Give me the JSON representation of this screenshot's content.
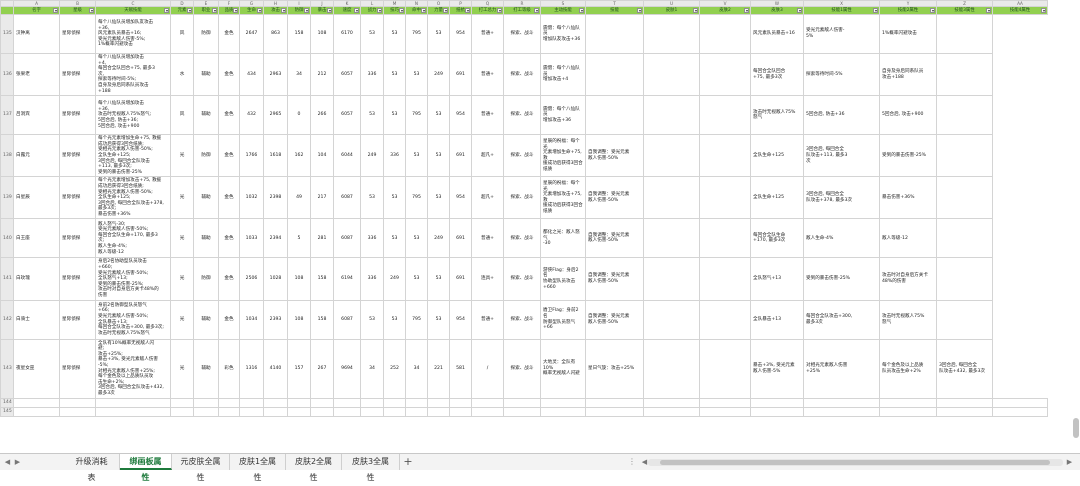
{
  "columns": [
    "",
    "A",
    "B",
    "C",
    "D",
    "E",
    "F",
    "G",
    "H",
    "I",
    "J",
    "K",
    "L",
    "M",
    "N",
    "O",
    "P",
    "Q",
    "R",
    "S",
    "T",
    "U",
    "V",
    "W",
    "X",
    "Y",
    "Z",
    "AA",
    "AB"
  ],
  "headers": [
    "名字",
    "星级",
    "天赋技能",
    "元素",
    "职业",
    "品质",
    "生命",
    "攻击",
    "防御",
    "暴击",
    "速度",
    "战力",
    "技巧",
    "命中",
    "力量",
    "抵抗",
    "打工总力",
    "打工等级",
    "主动技能",
    "技能",
    "皮肤1",
    "皮肤2",
    "皮肤3",
    "技能1属性",
    "技能2属性",
    "技能3属性",
    "技能4属性"
  ],
  "rows": [
    {
      "num": "135",
      "cells": [
        "汉钟离",
        "星际侦探",
        "每个八仙队员增加队友攻击\n+36,\n风元素队员暴击+16;\n受光元素敌人伤害-5%;\n1%概率闪避攻击",
        "风",
        "防御",
        "金色",
        "2647",
        "863",
        "158",
        "108",
        "6170",
        "53",
        "53",
        "795",
        "53",
        "954",
        "普通+",
        "探索、战斗",
        "震慑：每个八仙队员\n增加队友攻击+36",
        "",
        "",
        "",
        "风元素队员暴击+16",
        "受光元素敌人伤害-\n5%",
        "1%概率闪避攻击",
        ""
      ]
    },
    {
      "num": "136",
      "cells": [
        "张果老",
        "星际侦探",
        "每个八仙队员增加攻击\n+4,\n每回合全队回合+75, 最多3\n次,\n探索等待时间-5%;\n自身及身后同系队员攻击\n+188",
        "水",
        "辅助",
        "金色",
        "434",
        "2963",
        "34",
        "212",
        "6057",
        "336",
        "53",
        "53",
        "249",
        "691",
        "普通+",
        "探索、战斗",
        "震慑：每个八仙队员\n增加攻击+4",
        "",
        "",
        "",
        "每回合全队回合\n+75, 最多3次",
        "探索等待时间-5%",
        "自身及身后同系队员\n攻击+188",
        ""
      ]
    },
    {
      "num": "137",
      "cells": [
        "吕洞宾",
        "星际侦探",
        "每个八仙队员增加攻击\n+36,\n攻击时无视敌人75%怒气;\n5回合后, 防击+36;\n5回合后, 攻击+900",
        "风",
        "辅助",
        "金色",
        "432",
        "2965",
        "0",
        "266",
        "6057",
        "53",
        "53",
        "795",
        "53",
        "954",
        "普通+",
        "探索、战斗",
        "震慑：每个八仙队员\n增加攻击+36",
        "",
        "",
        "",
        "攻击时无视敌人75%\n怒气",
        "5回合后, 防击+36",
        "5回合后, 攻击+900",
        ""
      ]
    },
    {
      "num": "138",
      "cells": [
        "白露元",
        "星际侦探",
        "每个光元素增加生命+75, 救援\n成功后获得3回合纸质;\n受相光元素敌人伤害-50%;\n全队生命+125;\n3回合后, 每回合全队攻击\n+113, 最多3次;\n受到的暴击伤害-25%",
        "光",
        "防御",
        "金色",
        "1766",
        "1618",
        "162",
        "104",
        "6044",
        "249",
        "336",
        "53",
        "53",
        "691",
        "超凡+",
        "探索、战斗",
        "星辰的祝福：每个光\n元素增加生命+75, 救\n援成功后获得3回合纸质",
        "自我调整：受光元素\n敌人伤害-50%",
        "",
        "",
        "全队生命+125",
        "3回合后, 每回合全\n队攻击+113, 最多3\n次",
        "受到的暴击伤害-25%",
        ""
      ]
    },
    {
      "num": "139",
      "cells": [
        "白星辰",
        "星际侦探",
        "每个光元素增加攻击+75, 救援\n成功后获得3回合纸质;\n受相光元素敌人伤害-50%;\n全队生命+125;\n3回合后, 每回合全队攻击+378,\n最多3次;\n暴击伤害+36%",
        "光",
        "辅助",
        "金色",
        "1032",
        "2398",
        "49",
        "217",
        "6087",
        "53",
        "53",
        "795",
        "53",
        "954",
        "超凡+",
        "探索、战斗",
        "星辰的祝福：每个光\n元素增加攻击+75, 救\n援成功后获得3回合纸质",
        "自我调整：受光元素\n敌人伤害-50%",
        "",
        "",
        "全队生命+125",
        "3回合后, 每回合全\n队攻击+378, 最多3次",
        "暴击伤害+36%",
        ""
      ]
    },
    {
      "num": "140",
      "cells": [
        "白王座",
        "星际侦探",
        "敌人怒气-30;\n受光元素敌人伤害-50%;\n每回合全队生命+170, 最多3\n次;\n敌人生命-4%;\n敌人等级-12",
        "光",
        "辅助",
        "金色",
        "1033",
        "2394",
        "5",
        "281",
        "6087",
        "336",
        "53",
        "53",
        "249",
        "691",
        "普通+",
        "探索、战斗",
        "都化之光：敌人怒气\n-30",
        "自我调整：受光元素\n敌人伤害-50%",
        "",
        "",
        "每回合全队生命\n+170, 最多3次",
        "敌人生命-4%",
        "敌人等级-12",
        ""
      ]
    },
    {
      "num": "141",
      "cells": [
        "白玫瑰",
        "星际侦探",
        "身后2名协助型队员攻击\n+660;\n受光元素敌人伤害-50%;\n全队怒气+13;\n受到的暴击伤害-25%;\n攻击时对自身后方关卡48%的\n伤害",
        "光",
        "防御",
        "金色",
        "2506",
        "1028",
        "108",
        "158",
        "6194",
        "336",
        "249",
        "53",
        "53",
        "691",
        "连具+",
        "探索、战斗",
        "游侠Flag：身后2名\n协助型队员攻击+660",
        "自我调整：受光元素\n敌人伤害-50%",
        "",
        "",
        "全队怒气+13",
        "受到的暴击伤害-25%",
        "攻击时对自身后方关卡\n48%的伤害",
        ""
      ]
    },
    {
      "num": "142",
      "cells": [
        "白骑士",
        "星际侦探",
        "身前2名防御型队员怒气\n+66;\n受光元素敌人伤害-50%;\n全队暴击+13;\n每回合全队攻击+300, 最多3次;\n攻击时无视敌人75%怒气",
        "光",
        "辅助",
        "金色",
        "1034",
        "2393",
        "108",
        "158",
        "6087",
        "53",
        "53",
        "795",
        "53",
        "954",
        "普通+",
        "探索、战斗",
        "盾卫Flag：身前2名\n防御型队员怒气+66",
        "自我调整：受光元素\n敌人伤害-50%",
        "",
        "",
        "全队暴击+13",
        "每回合全队攻击+300,\n最多3次",
        "攻击时无视敌人75%\n怒气",
        ""
      ]
    },
    {
      "num": "143",
      "cells": [
        "夜星女巫",
        "星际侦探",
        "全队有10%概率无视敌人闪\n避;\n攻击+25%;\n暴击+3%, 受光元素敌人伤害\n-5%;\n对相光元素敌人伤害+25%;\n每个金色及以上品质队员攻\n击生命+2%;\n3回合后, 每回合全队攻击+432,\n最多3次",
        "光",
        "辅助",
        "彩色",
        "1316",
        "4140",
        "157",
        "267",
        "9694",
        "34",
        "252",
        "34",
        "221",
        "581",
        "/",
        "探索、战斗",
        "大地灵：全队有10%\n概率无视敌人闪避",
        "星日气旋：攻击+25%",
        "",
        "",
        "暴击+3%, 受光元素\n敌人伤害-5%",
        "对相光元素敌人伤害\n+25%",
        "每个金色及以上品质\n队员攻击生命+2%",
        "3回合后, 每回合全\n队攻击+432, 最多3次"
      ]
    }
  ],
  "empty_rows": [
    "144",
    "145"
  ],
  "tabs": [
    "升级消耗表",
    "绑画板属性",
    "元皮肤全属性",
    "皮肤1全属性",
    "皮肤2全属性",
    "皮肤3全属性"
  ],
  "active_tab": 1,
  "ui": {
    "add_sheet": "+",
    "nav_first": "◀",
    "nav_last": "▶",
    "more": "⋮",
    "scroll_left": "◀",
    "scroll_right": "▶"
  }
}
